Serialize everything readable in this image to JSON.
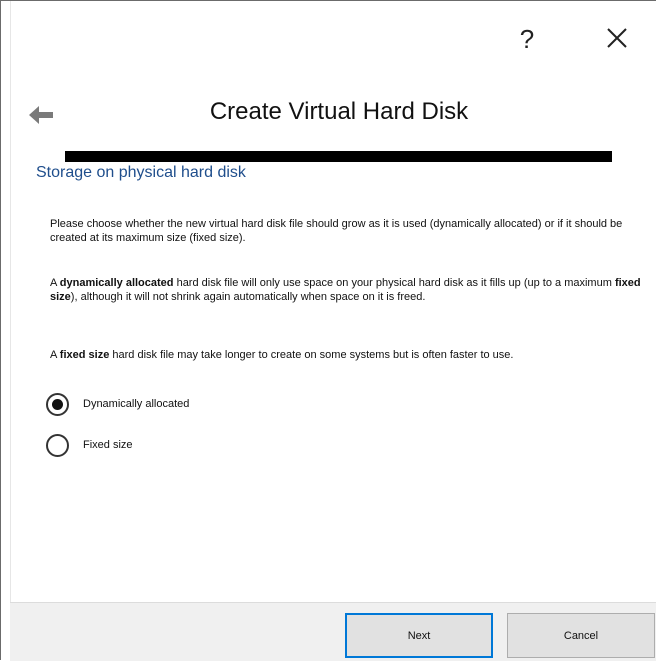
{
  "dialog": {
    "help_label": "?",
    "title": "Create Virtual Hard Disk",
    "section_title": "Storage on physical hard disk"
  },
  "description": {
    "p1": "Please choose whether the new virtual hard disk file should grow as it is used (dynamically allocated) or if it should be created at its maximum size (fixed size).",
    "p2_prefix": "A ",
    "p2_bold1": "dynamically allocated",
    "p2_mid": " hard disk file will only use space on your physical hard disk as it fills up (up to a maximum ",
    "p2_bold2": "fixed size",
    "p2_suffix": "), although it will not shrink again automatically when space on it is freed.",
    "p3_prefix": "A ",
    "p3_bold": "fixed size",
    "p3_suffix": " hard disk file may take longer to create on some systems but is often faster to use."
  },
  "options": {
    "dynamic_label": "Dynamically allocated",
    "fixed_label": "Fixed size",
    "selected": "Dynamically allocated"
  },
  "buttons": {
    "next_label": "Next",
    "cancel_label": "Cancel"
  },
  "icons": {
    "back": "back-arrow-icon",
    "close": "close-icon"
  }
}
